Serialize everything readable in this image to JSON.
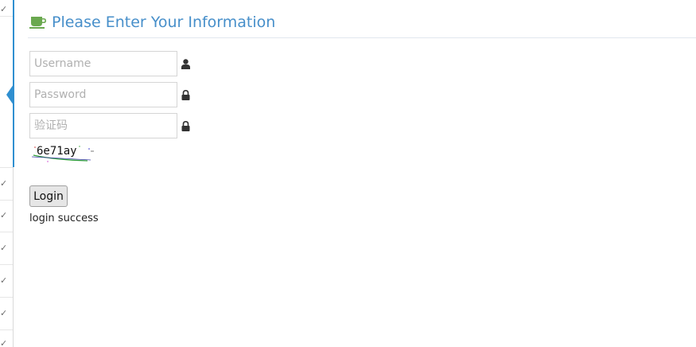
{
  "header": {
    "title": "Please Enter Your Information",
    "icon": "coffee-cup-icon",
    "title_color": "#478fca",
    "icon_color": "#6aa84f"
  },
  "sidebar": {
    "accent_color": "#2f8fd0",
    "chevron": "✓"
  },
  "form": {
    "username": {
      "value": "",
      "placeholder": "Username",
      "icon": "user-icon"
    },
    "password": {
      "value": "",
      "placeholder": "Password",
      "icon": "lock-icon"
    },
    "captcha_input": {
      "value": "",
      "placeholder": "验证码",
      "icon": "lock-icon"
    },
    "captcha_image_text": "6e71ay",
    "login_label": "Login"
  },
  "status": {
    "message": "login success"
  }
}
